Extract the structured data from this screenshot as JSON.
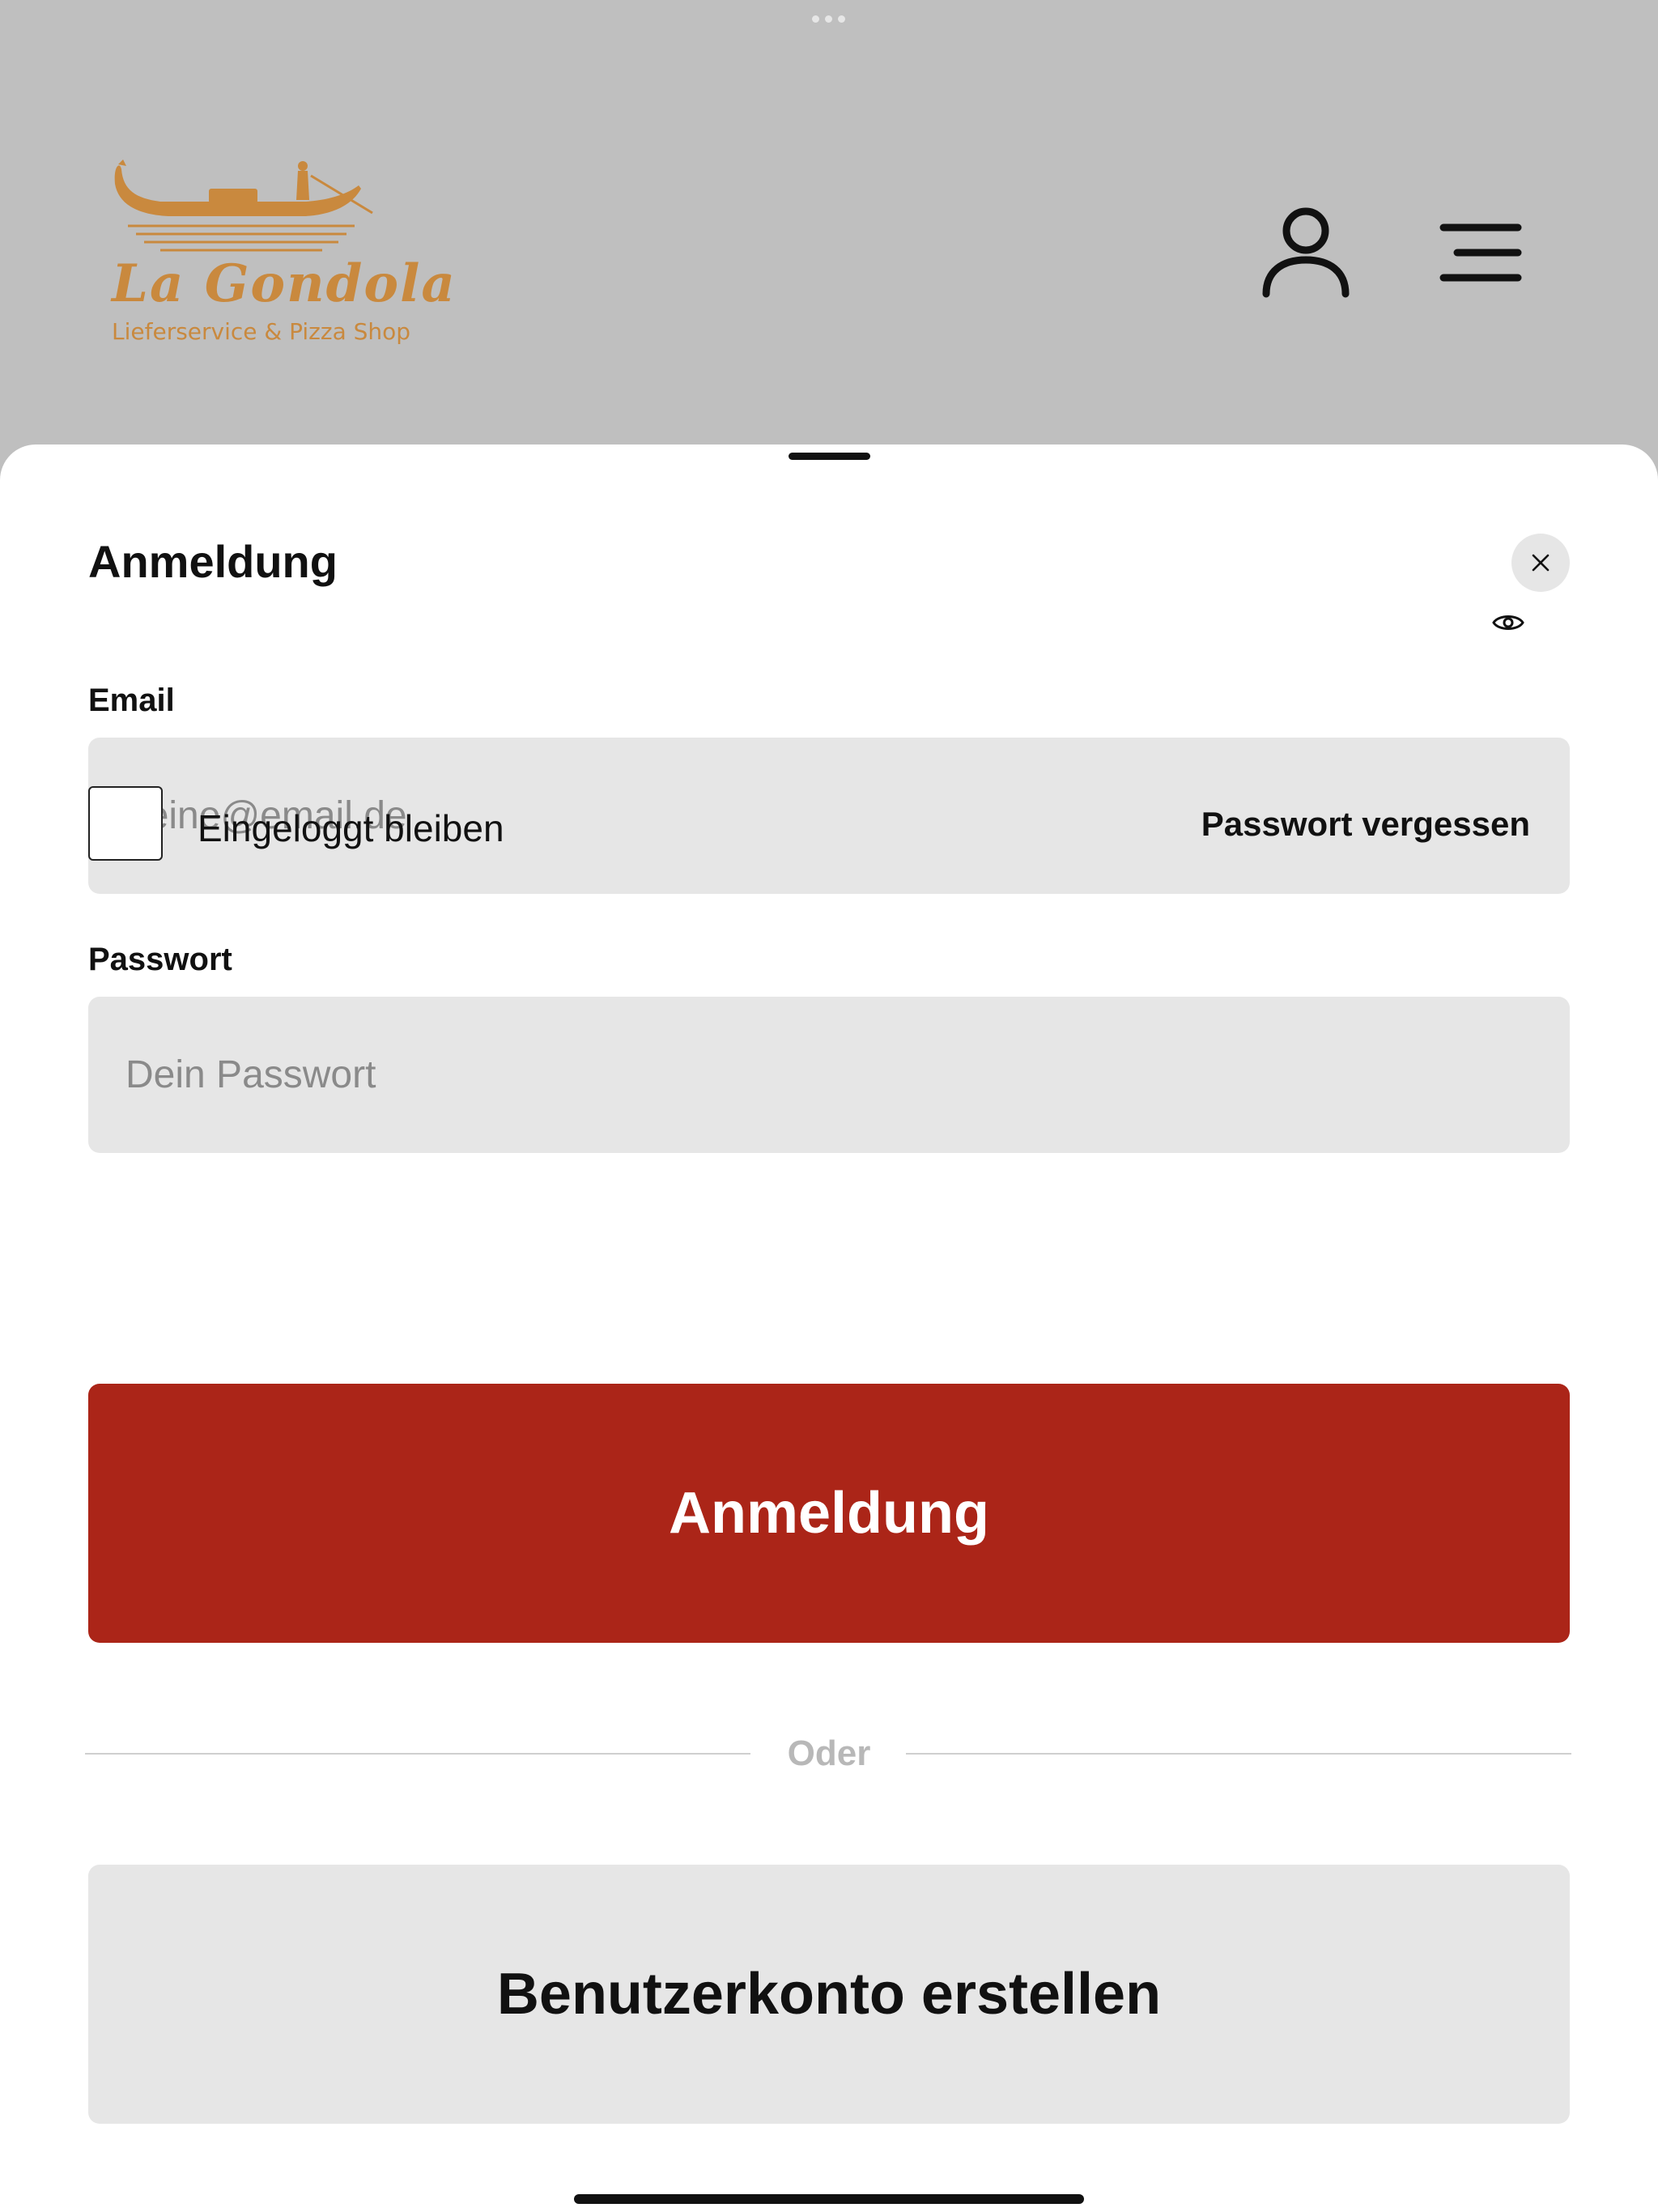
{
  "header": {
    "logo_title": "La Gondola",
    "logo_subtitle": "Lieferservice & Pizza Shop",
    "brand_color": "#c9893e",
    "icons": [
      "gondola-logo-icon",
      "user-icon",
      "menu-icon"
    ]
  },
  "login_sheet": {
    "title": "Anmeldung",
    "close_icon": "close-icon",
    "email": {
      "label": "Email",
      "placeholder": "deine@email.de",
      "value": ""
    },
    "password": {
      "label": "Passwort",
      "placeholder": "Dein Passwort",
      "value": "",
      "toggle_icon": "eye-icon"
    },
    "remember_me": {
      "label": "Eingeloggt bleiben",
      "checked": false
    },
    "forgot_password_label": "Passwort vergessen",
    "submit_label": "Anmeldung",
    "divider_label": "Oder",
    "create_account_label": "Benutzerkonto erstellen"
  },
  "colors": {
    "primary": "#ab2518",
    "overlay": "#bfbfbf",
    "field_background": "#e6e6e6"
  }
}
